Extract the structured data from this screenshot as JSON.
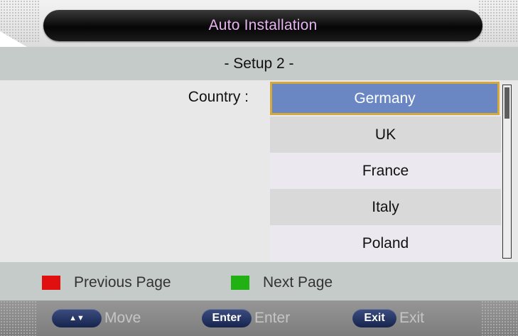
{
  "header": {
    "title": "Auto Installation"
  },
  "subheader": {
    "title": "- Setup 2 -"
  },
  "country_field": {
    "label": "Country :",
    "selected": "Germany",
    "options": [
      "Germany",
      "UK",
      "France",
      "Italy",
      "Poland"
    ]
  },
  "legend": {
    "previous": {
      "label": "Previous Page",
      "color": "#e01010"
    },
    "next": {
      "label": "Next Page",
      "color": "#22b112"
    }
  },
  "footer": {
    "move": {
      "key": "▲▼",
      "label": "Move"
    },
    "enter": {
      "key": "Enter",
      "label": "Enter"
    },
    "exit": {
      "key": "Exit",
      "label": "Exit"
    }
  },
  "colors": {
    "selected_bg": "#6a87c4",
    "selected_border": "#d4a93a",
    "title_text": "#e7b3f0"
  }
}
